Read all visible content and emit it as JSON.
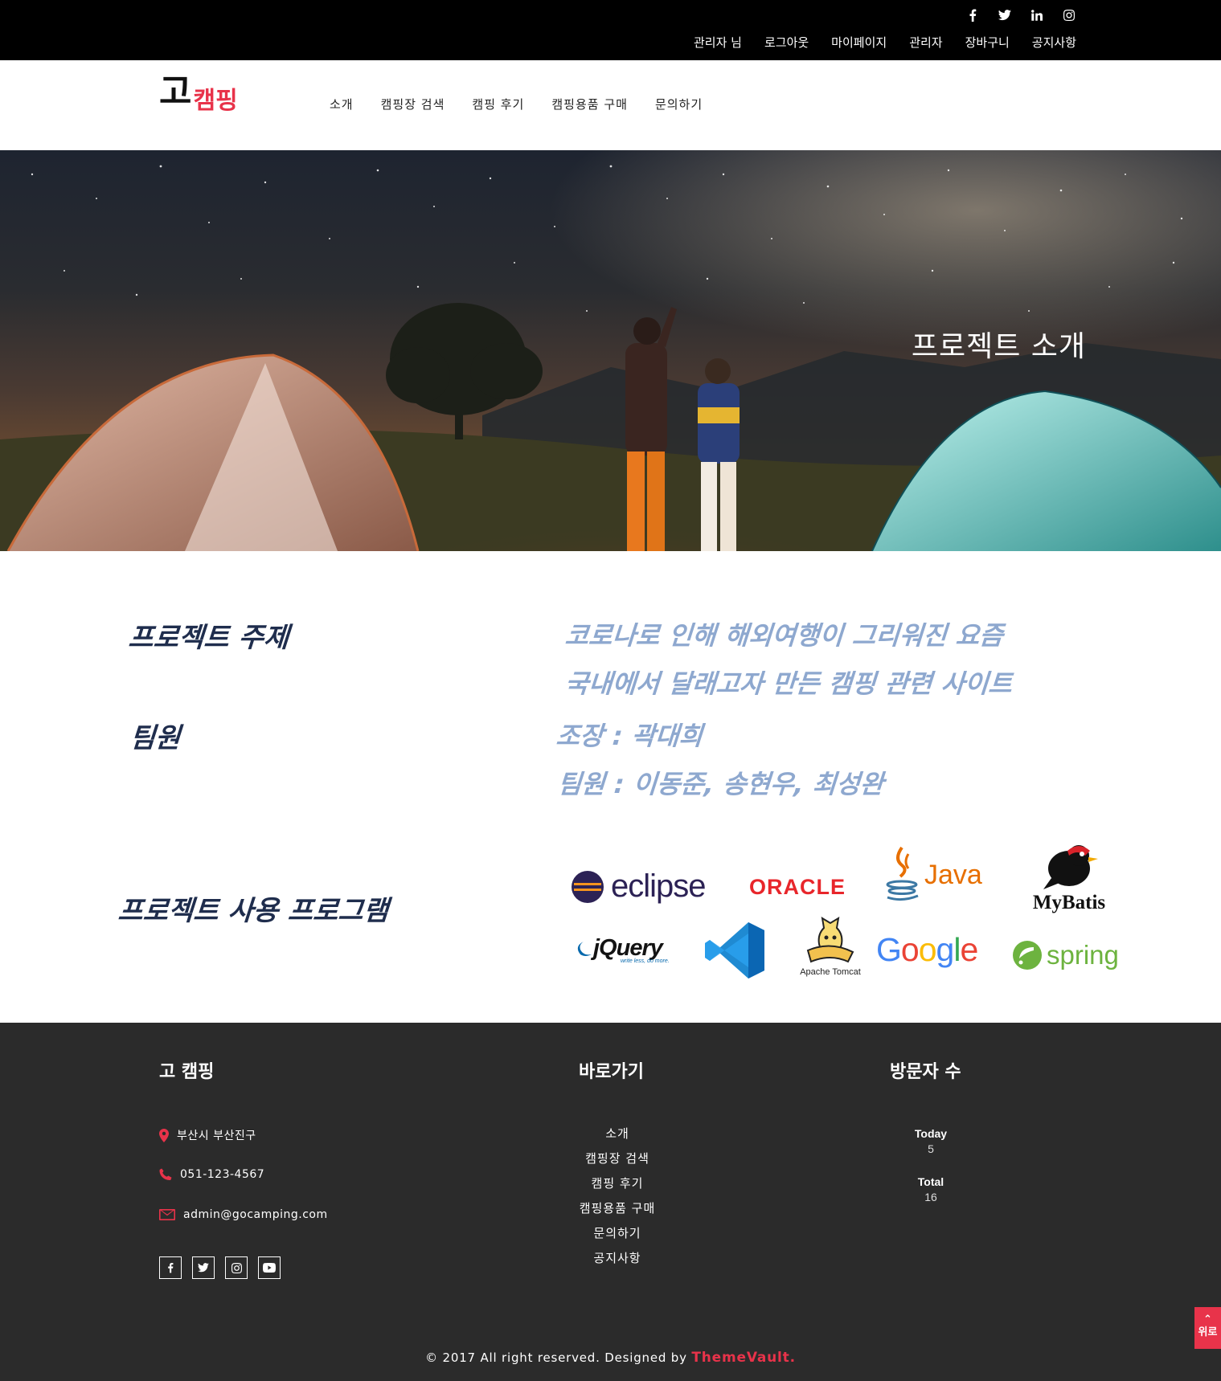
{
  "topbar": {
    "social": [
      "facebook-icon",
      "twitter-icon",
      "linkedin-icon",
      "instagram-icon"
    ],
    "links": [
      "관리자 님",
      "로그아웃",
      "마이페이지",
      "관리자",
      "장바구니",
      "공지사항"
    ]
  },
  "header": {
    "logo_big": "고",
    "logo_small": "캠핑",
    "nav": [
      "소개",
      "캠핑장 검색",
      "캠핑 후기",
      "캠핑용품 구매",
      "문의하기"
    ]
  },
  "hero": {
    "title": "프로젝트 소개"
  },
  "content": {
    "topic_label": "프로젝트 주제",
    "topic_line1": "코로나로 인해 해외여행이 그리워진 요즘",
    "topic_line2": "국내에서 달래고자 만든 캠핑 관련 사이트",
    "team_label": "팀원",
    "team_leader": "조장 : 곽대희",
    "team_members": "팀원 :  이동준, 송현우, 최성완",
    "programs_label": "프로젝트 사용 프로그램",
    "logos": {
      "eclipse": "eclipse",
      "oracle": "ORACLE",
      "java": "Java",
      "mybatis": "MyBatis",
      "jquery": "jQuery",
      "jquery_tag": "write less, do more.",
      "tomcat": "Apache Tomcat",
      "google": [
        "G",
        "o",
        "o",
        "g",
        "l",
        "e"
      ],
      "spring": "spring"
    }
  },
  "footer": {
    "brand_title": "고 캠핑",
    "address": "부산시 부산진구",
    "phone": "051-123-4567",
    "email": "admin@gocamping.com",
    "social": [
      "facebook-icon",
      "twitter-icon",
      "instagram-icon",
      "youtube-icon"
    ],
    "links_title": "바로가기",
    "links": [
      "소개",
      "캠핑장 검색",
      "캠핑 후기",
      "캠핑용품 구매",
      "문의하기",
      "공지사항"
    ],
    "visitors_title": "방문자 수",
    "today_label": "Today",
    "today_value": "5",
    "total_label": "Total",
    "total_value": "16",
    "copyright_text": "© 2017 All right reserved. Designed by ",
    "copyright_brand": "ThemeVault.",
    "to_top": "위로"
  },
  "colors": {
    "accent": "#e8334a",
    "label": "#1f2d4d",
    "desc": "#8ea8cf",
    "footer_bg": "#2b2b2b"
  }
}
